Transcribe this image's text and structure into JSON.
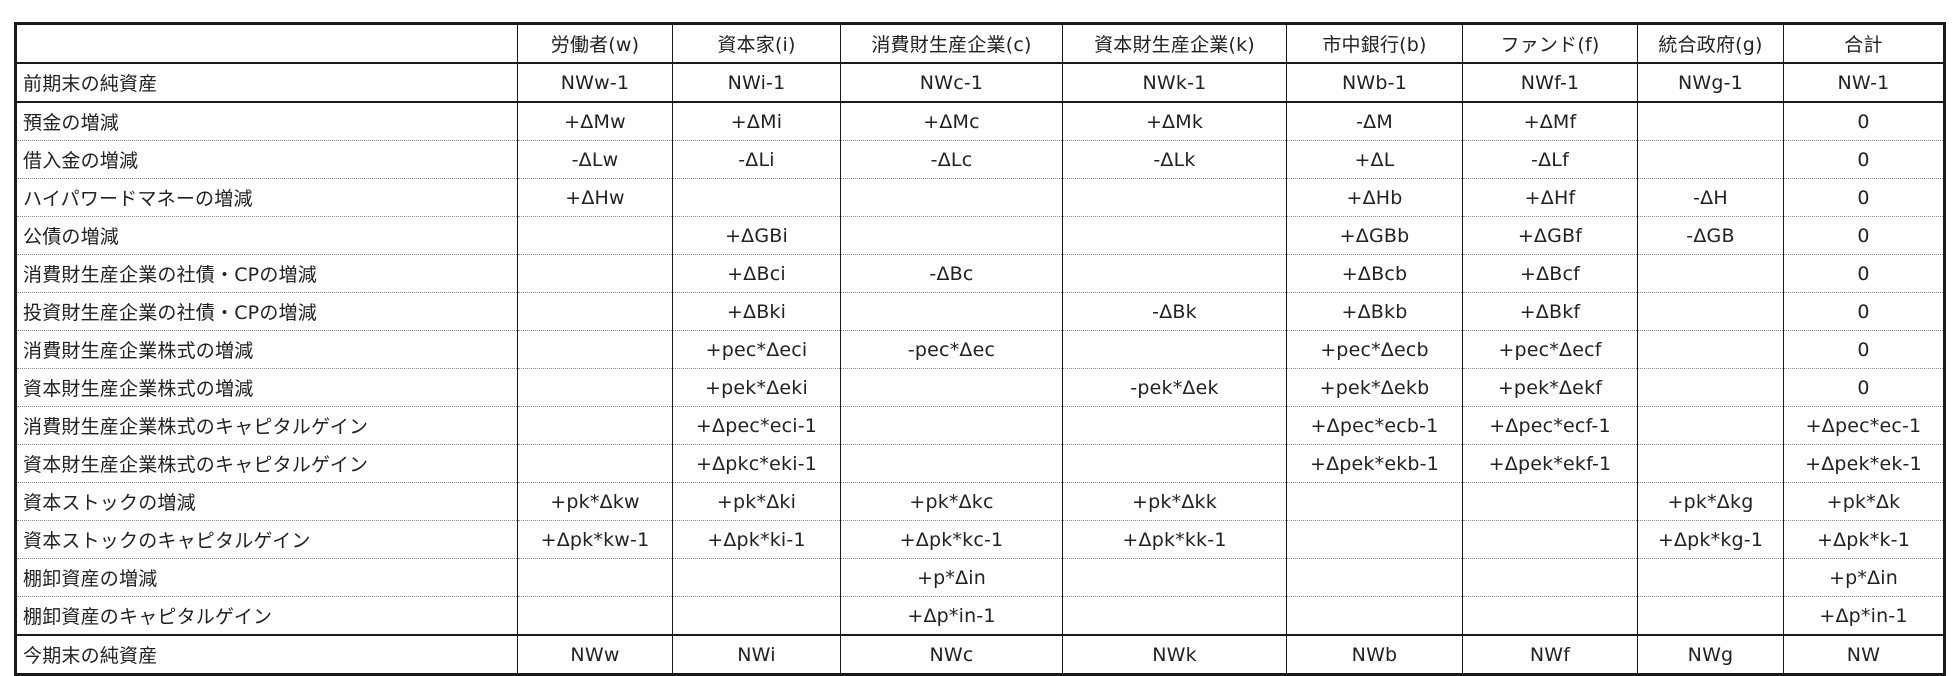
{
  "table": {
    "corner": "",
    "headers": [
      "労働者(w)",
      "資本家(i)",
      "消費財生産企業(c)",
      "資本財生産企業(k)",
      "市中銀行(b)",
      "ファンド(f)",
      "統合政府(g)",
      "合計"
    ],
    "rows": [
      {
        "label": "前期末の純資産",
        "cells": [
          "NWw-1",
          "NWi-1",
          "NWc-1",
          "NWk-1",
          "NWb-1",
          "NWf-1",
          "NWg-1",
          "NW-1"
        ]
      },
      {
        "label": "預金の増減",
        "cells": [
          "+ΔMw",
          "+ΔMi",
          "+ΔMc",
          "+ΔMk",
          "-ΔM",
          "+ΔMf",
          "",
          "0"
        ]
      },
      {
        "label": "借入金の増減",
        "cells": [
          "-ΔLw",
          "-ΔLi",
          "-ΔLc",
          "-ΔLk",
          "+ΔL",
          "-ΔLf",
          "",
          "0"
        ]
      },
      {
        "label": "ハイパワードマネーの増減",
        "cells": [
          "+ΔHw",
          "",
          "",
          "",
          "+ΔHb",
          "+ΔHf",
          "-ΔH",
          "0"
        ]
      },
      {
        "label": "公債の増減",
        "cells": [
          "",
          "+ΔGBi",
          "",
          "",
          "+ΔGBb",
          "+ΔGBf",
          "-ΔGB",
          "0"
        ]
      },
      {
        "label": "消費財生産企業の社債・CPの増減",
        "cells": [
          "",
          "+ΔBci",
          "-ΔBc",
          "",
          "+ΔBcb",
          "+ΔBcf",
          "",
          "0"
        ]
      },
      {
        "label": "投資財生産企業の社債・CPの増減",
        "cells": [
          "",
          "+ΔBki",
          "",
          "-ΔBk",
          "+ΔBkb",
          "+ΔBkf",
          "",
          "0"
        ]
      },
      {
        "label": "消費財生産企業株式の増減",
        "cells": [
          "",
          "+pec*Δeci",
          "-pec*Δec",
          "",
          "+pec*Δecb",
          "+pec*Δecf",
          "",
          "0"
        ]
      },
      {
        "label": "資本財生産企業株式の増減",
        "cells": [
          "",
          "+pek*Δeki",
          "",
          "-pek*Δek",
          "+pek*Δekb",
          "+pek*Δekf",
          "",
          "0"
        ]
      },
      {
        "label": "消費財生産企業株式のキャピタルゲイン",
        "cells": [
          "",
          "+Δpec*eci-1",
          "",
          "",
          "+Δpec*ecb-1",
          "+Δpec*ecf-1",
          "",
          "+Δpec*ec-1"
        ]
      },
      {
        "label": "資本財生産企業株式のキャピタルゲイン",
        "cells": [
          "",
          "+Δpkc*eki-1",
          "",
          "",
          "+Δpek*ekb-1",
          "+Δpek*ekf-1",
          "",
          "+Δpek*ek-1"
        ]
      },
      {
        "label": "資本ストックの増減",
        "cells": [
          "+pk*Δkw",
          "+pk*Δki",
          "+pk*Δkc",
          "+pk*Δkk",
          "",
          "",
          "+pk*Δkg",
          "+pk*Δk"
        ]
      },
      {
        "label": "資本ストックのキャピタルゲイン",
        "cells": [
          "+Δpk*kw-1",
          "+Δpk*ki-1",
          "+Δpk*kc-1",
          "+Δpk*kk-1",
          "",
          "",
          "+Δpk*kg-1",
          "+Δpk*k-1"
        ]
      },
      {
        "label": "棚卸資産の増減",
        "cells": [
          "",
          "",
          "+p*Δin",
          "",
          "",
          "",
          "",
          "+p*Δin"
        ]
      },
      {
        "label": "棚卸資産のキャピタルゲイン",
        "cells": [
          "",
          "",
          "+Δp*in-1",
          "",
          "",
          "",
          "",
          "+Δp*in-1"
        ]
      },
      {
        "label": "今期末の純資産",
        "cells": [
          "NWw",
          "NWi",
          "NWc",
          "NWk",
          "NWb",
          "NWf",
          "NWg",
          "NW"
        ]
      }
    ]
  }
}
